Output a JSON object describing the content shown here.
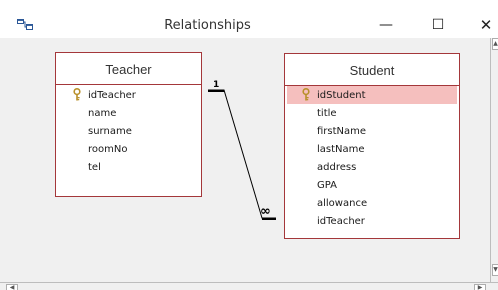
{
  "window": {
    "title": "Relationships",
    "minimize_glyph": "—",
    "maximize_glyph": "☐",
    "close_glyph": "✕",
    "icon": "relationships-icon"
  },
  "colors": {
    "table_border": "#a4373a",
    "selected_row": "#f5bfbe",
    "canvas": "#f0f0f0",
    "key_icon": "#c8a23a"
  },
  "tables": {
    "teacher": {
      "name": "Teacher",
      "fields": [
        {
          "label": "idTeacher",
          "key": true
        },
        {
          "label": "name",
          "key": false
        },
        {
          "label": "surname",
          "key": false
        },
        {
          "label": "roomNo",
          "key": false
        },
        {
          "label": "tel",
          "key": false
        }
      ]
    },
    "student": {
      "name": "Student",
      "fields": [
        {
          "label": "idStudent",
          "key": true,
          "selected": true
        },
        {
          "label": "title",
          "key": false
        },
        {
          "label": "firstName",
          "key": false
        },
        {
          "label": "lastName",
          "key": false
        },
        {
          "label": "address",
          "key": false
        },
        {
          "label": "GPA",
          "key": false
        },
        {
          "label": "allowance",
          "key": false
        },
        {
          "label": "idTeacher",
          "key": false
        }
      ]
    }
  },
  "relationship": {
    "one_label": "1",
    "many_label": "∞"
  }
}
